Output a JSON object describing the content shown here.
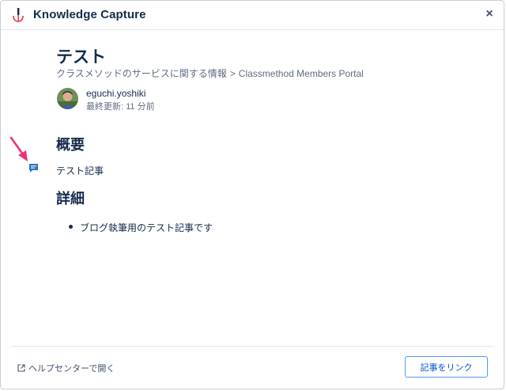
{
  "header": {
    "title": "Knowledge Capture",
    "close_label": "×"
  },
  "article": {
    "title": "テスト",
    "breadcrumb": {
      "space": "クラスメソッドのサービスに関する情報",
      "separator": ">",
      "portal": "Classmethod Members Portal"
    },
    "author": {
      "name": "eguchi.yoshiki",
      "updated": "最終更新: 11 分前"
    },
    "sections": {
      "summary_heading": "概要",
      "summary_text": "テスト記事",
      "detail_heading": "詳細",
      "detail_items": [
        "ブログ執筆用のテスト記事です"
      ]
    }
  },
  "footer": {
    "help_link": "ヘルプセンターで開く",
    "link_button": "記事をリンク"
  },
  "colors": {
    "accent": "#0052cc",
    "button_border": "#4c9aff",
    "annotation_arrow": "#f0307a",
    "comment_icon": "#2f73c4"
  }
}
